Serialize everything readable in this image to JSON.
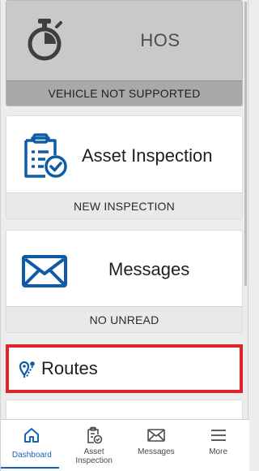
{
  "cards": {
    "hos": {
      "title": "HOS",
      "status": "VEHICLE NOT SUPPORTED",
      "icon": "stopwatch-icon"
    },
    "asset_inspection": {
      "title": "Asset Inspection",
      "status": "NEW INSPECTION",
      "icon": "clipboard-check-icon"
    },
    "messages": {
      "title": "Messages",
      "status": "NO UNREAD",
      "icon": "envelope-icon"
    }
  },
  "routes": {
    "label": "Routes",
    "icon": "route-pin-icon",
    "highlight_color": "#e0232d"
  },
  "tabs": [
    {
      "label": "Dashboard",
      "icon": "home-icon",
      "active": true
    },
    {
      "label": "Asset\nInspection",
      "icon": "clipboard-check-icon",
      "active": false
    },
    {
      "label": "Messages",
      "icon": "envelope-icon",
      "active": false
    },
    {
      "label": "More",
      "icon": "menu-icon",
      "active": false
    }
  ],
  "colors": {
    "accent": "#1565b3",
    "icon_blue": "#0f5ba8",
    "disabled_gray": "#c9c9c9"
  }
}
